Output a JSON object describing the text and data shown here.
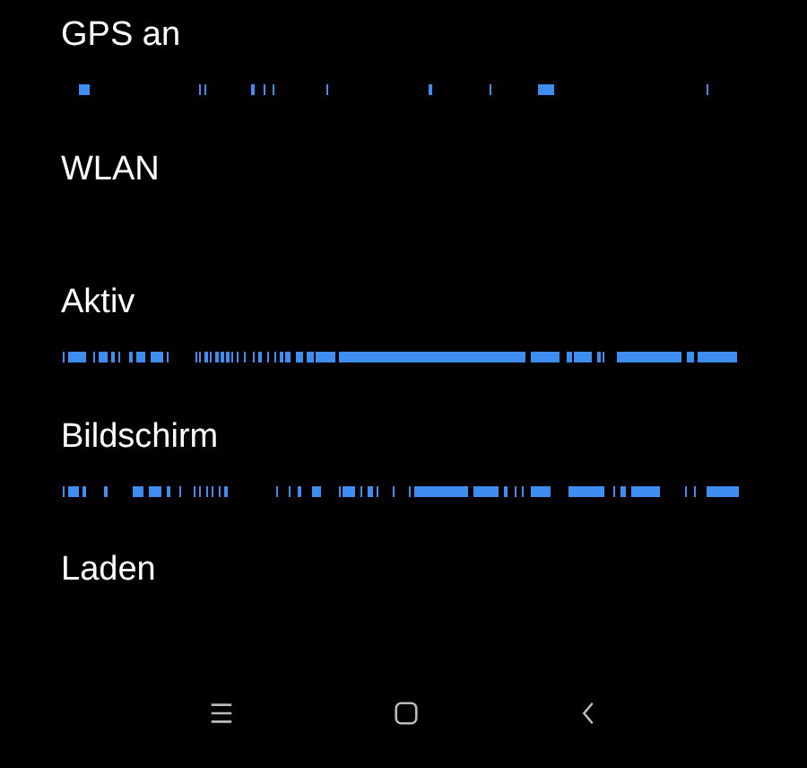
{
  "rows": [
    {
      "label": "GPS an",
      "kind": "timeline"
    },
    {
      "label": "WLAN",
      "kind": "plain"
    },
    {
      "label": "Aktiv",
      "kind": "timeline"
    },
    {
      "label": "Bildschirm",
      "kind": "timeline"
    },
    {
      "label": "Laden",
      "kind": "plain"
    }
  ]
}
